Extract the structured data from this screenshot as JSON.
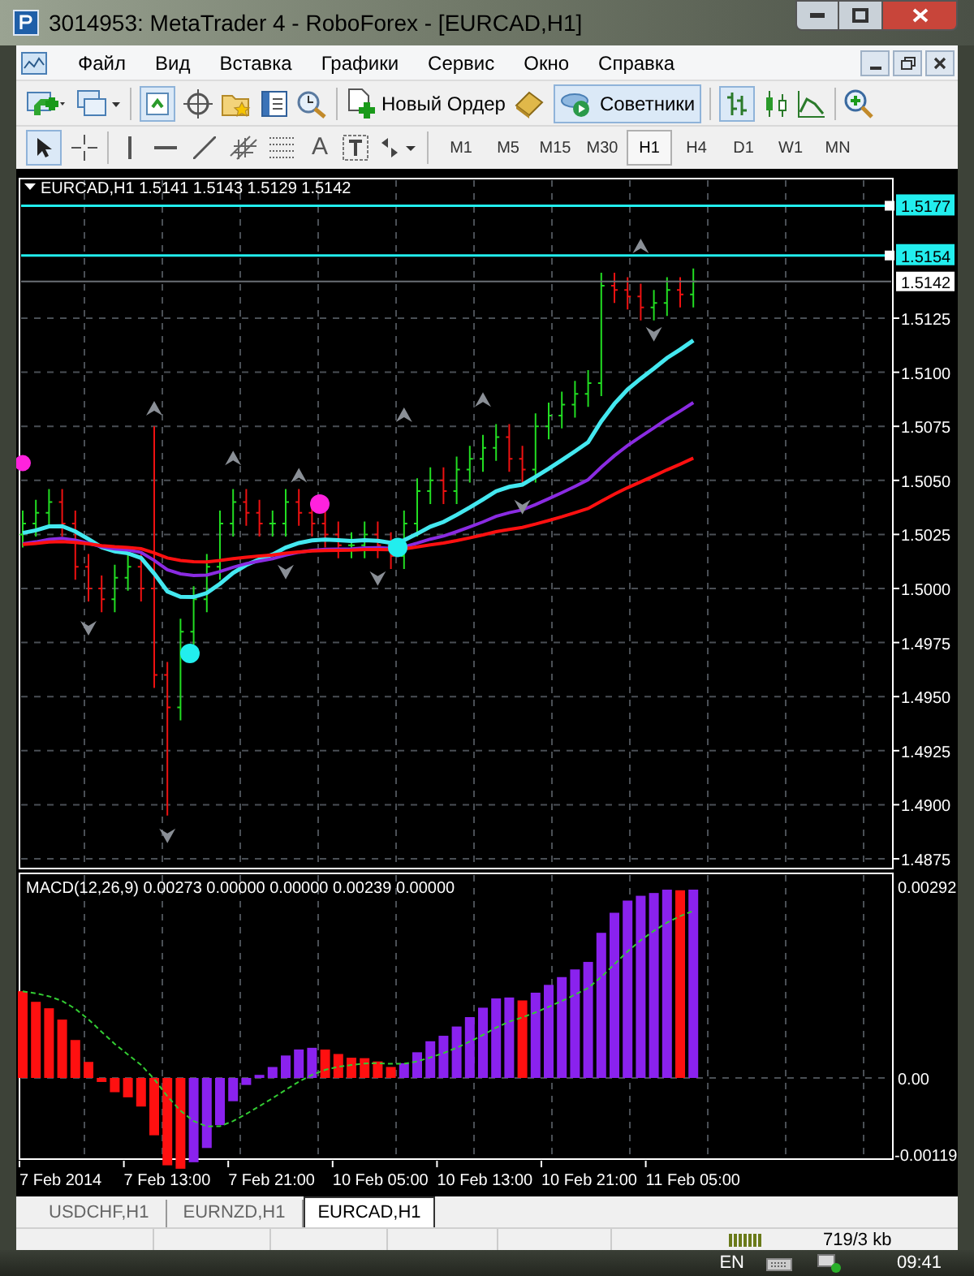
{
  "window": {
    "title": "3014953: MetaTrader 4 - RoboForex - [EURCAD,H1]"
  },
  "menu": [
    "Файл",
    "Вид",
    "Вставка",
    "Графики",
    "Сервис",
    "Окно",
    "Справка"
  ],
  "toolbar": {
    "new_order": "Новый Ордер",
    "experts": "Советники",
    "text_tool": "A"
  },
  "timeframes": [
    {
      "label": "M1",
      "selected": false
    },
    {
      "label": "M5",
      "selected": false
    },
    {
      "label": "M15",
      "selected": false
    },
    {
      "label": "M30",
      "selected": false
    },
    {
      "label": "H1",
      "selected": true
    },
    {
      "label": "H4",
      "selected": false
    },
    {
      "label": "D1",
      "selected": false
    },
    {
      "label": "W1",
      "selected": false
    },
    {
      "label": "MN",
      "selected": false
    }
  ],
  "chart": {
    "header": "EURCAD,H1  1.5141 1.5143 1.5129 1.5142",
    "price_labels": [
      "1.5125",
      "1.5100",
      "1.5075",
      "1.5050",
      "1.5025",
      "1.5000",
      "1.4975",
      "1.4950",
      "1.4925",
      "1.4900",
      "1.4875"
    ],
    "levels": [
      {
        "label": "1.5177"
      },
      {
        "label": "1.5154"
      }
    ],
    "current_price": "1.5142"
  },
  "macd": {
    "header": "MACD(12,26,9) 0.00273 0.00000 0.00000 0.00239 0.00000",
    "max_label": "0.00292",
    "zero_label": "0.00",
    "min_label": "-0.00119"
  },
  "time_labels": [
    "7 Feb 2014",
    "7 Feb 13:00",
    "7 Feb 21:00",
    "10 Feb 05:00",
    "10 Feb 13:00",
    "10 Feb 21:00",
    "11 Feb 05:00"
  ],
  "tabs": [
    {
      "label": "USDCHF,H1",
      "selected": false
    },
    {
      "label": "EURNZD,H1",
      "selected": false
    },
    {
      "label": "EURCAD,H1",
      "selected": true
    }
  ],
  "status_bar": {
    "traffic": "719/3 kb"
  },
  "taskbar": {
    "language": "EN",
    "clock": "09:41"
  }
}
